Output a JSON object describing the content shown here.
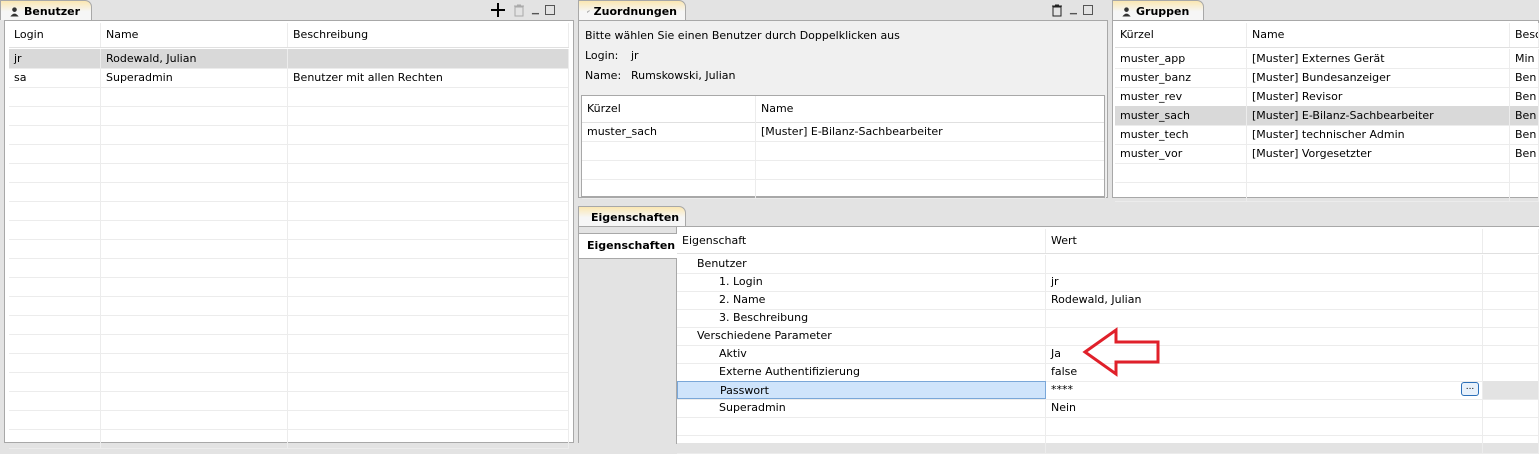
{
  "benutzer": {
    "tab_label": "Benutzer",
    "columns": [
      "Login",
      "Name",
      "Beschreibung"
    ],
    "rows": [
      {
        "login": "jr",
        "name": "Rodewald, Julian",
        "beschreibung": ""
      },
      {
        "login": "sa",
        "name": "Superadmin",
        "beschreibung": "Benutzer mit allen Rechten"
      }
    ]
  },
  "zuordnungen": {
    "tab_label": "Zuordnungen",
    "hint": "Bitte wählen Sie einen Benutzer durch Doppelklicken aus",
    "login_label": "Login:",
    "login_value": "jr",
    "name_label": "Name:",
    "name_value": "Rumskowski, Julian",
    "columns": [
      "Kürzel",
      "Name"
    ],
    "rows": [
      {
        "kuerzel": "muster_sach",
        "name": "[Muster] E-Bilanz-Sachbearbeiter"
      }
    ]
  },
  "gruppen": {
    "tab_label": "Gruppen",
    "columns": [
      "Kürzel",
      "Name",
      "Besc"
    ],
    "rows": [
      {
        "kuerzel": "muster_app",
        "name": "[Muster] Externes Gerät",
        "besc": "Min"
      },
      {
        "kuerzel": "muster_banz",
        "name": "[Muster] Bundesanzeiger",
        "besc": "Ben"
      },
      {
        "kuerzel": "muster_rev",
        "name": "[Muster] Revisor",
        "besc": "Ben"
      },
      {
        "kuerzel": "muster_sach",
        "name": "[Muster] E-Bilanz-Sachbearbeiter",
        "besc": "Ben"
      },
      {
        "kuerzel": "muster_tech",
        "name": "[Muster] technischer Admin",
        "besc": "Ben"
      },
      {
        "kuerzel": "muster_vor",
        "name": "[Muster] Vorgesetzter",
        "besc": "Ben"
      }
    ]
  },
  "eigenschaften": {
    "tab_label": "Eigenschaften",
    "side_tab": "Eigenschaften",
    "columns": [
      "Eigenschaft",
      "Wert"
    ],
    "rows": [
      {
        "label": "Benutzer",
        "value": ""
      },
      {
        "label": "1. Login",
        "value": "jr"
      },
      {
        "label": "2. Name",
        "value": "Rodewald, Julian"
      },
      {
        "label": "3. Beschreibung",
        "value": ""
      },
      {
        "label": "Verschiedene Parameter",
        "value": ""
      },
      {
        "label": "Aktiv",
        "value": "Ja"
      },
      {
        "label": "Externe Authentifizierung",
        "value": "false"
      },
      {
        "label": "Passwort",
        "value": "****"
      },
      {
        "label": "Superadmin",
        "value": "Nein"
      }
    ],
    "ellipsis_label": "..."
  },
  "colors": {
    "annotation_arrow": "#e0202a",
    "selection_row": "#d9d9d9",
    "edit_row": "#cfe4fb"
  }
}
